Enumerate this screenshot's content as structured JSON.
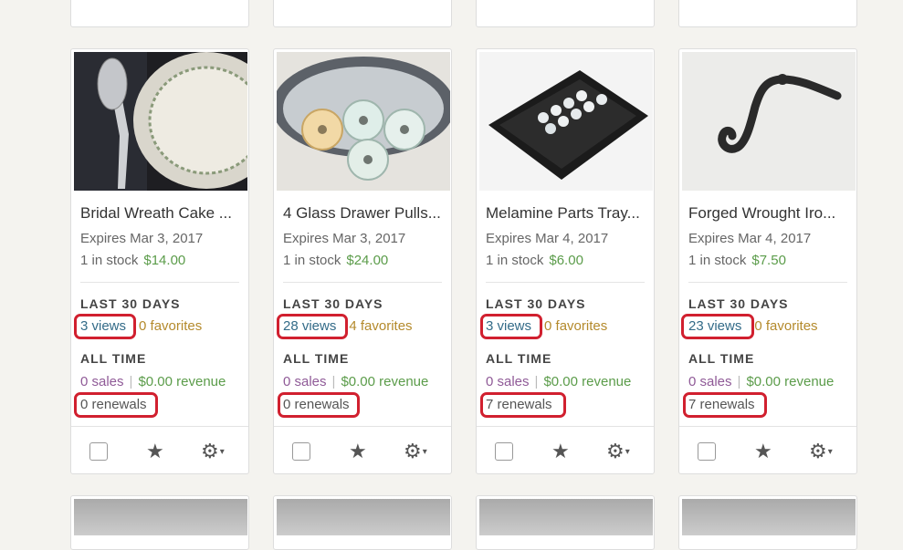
{
  "labels": {
    "last30": "LAST 30 DAYS",
    "alltime": "ALL TIME",
    "sep": "|"
  },
  "icons": {
    "star": "★",
    "gear": "⚙",
    "caret": "▾"
  },
  "colors": {
    "price": "#5b9c4a",
    "views": "#336b88",
    "favorites": "#b48a2c",
    "sales": "#8f5a97",
    "highlight_box": "#d1202f"
  },
  "listings": [
    {
      "title": "Bridal Wreath Cake ...",
      "expires": "Expires Mar 3, 2017",
      "stock": "1 in stock",
      "price": "$14.00",
      "views": "3 views",
      "favorites": "0 favorites",
      "sales": "0 sales",
      "revenue": "$0.00 revenue",
      "renewals": "0 renewals"
    },
    {
      "title": "4 Glass Drawer Pulls...",
      "expires": "Expires Mar 3, 2017",
      "stock": "1 in stock",
      "price": "$24.00",
      "views": "28 views",
      "favorites": "4 favorites",
      "sales": "0 sales",
      "revenue": "$0.00 revenue",
      "renewals": "0 renewals"
    },
    {
      "title": "Melamine Parts Tray...",
      "expires": "Expires Mar 4, 2017",
      "stock": "1 in stock",
      "price": "$6.00",
      "views": "3 views",
      "favorites": "0 favorites",
      "sales": "0 sales",
      "revenue": "$0.00 revenue",
      "renewals": "7 renewals"
    },
    {
      "title": "Forged Wrought Iro...",
      "expires": "Expires Mar 4, 2017",
      "stock": "1 in stock",
      "price": "$7.50",
      "views": "23 views",
      "favorites": "0 favorites",
      "sales": "0 sales",
      "revenue": "$0.00 revenue",
      "renewals": "7 renewals"
    }
  ]
}
